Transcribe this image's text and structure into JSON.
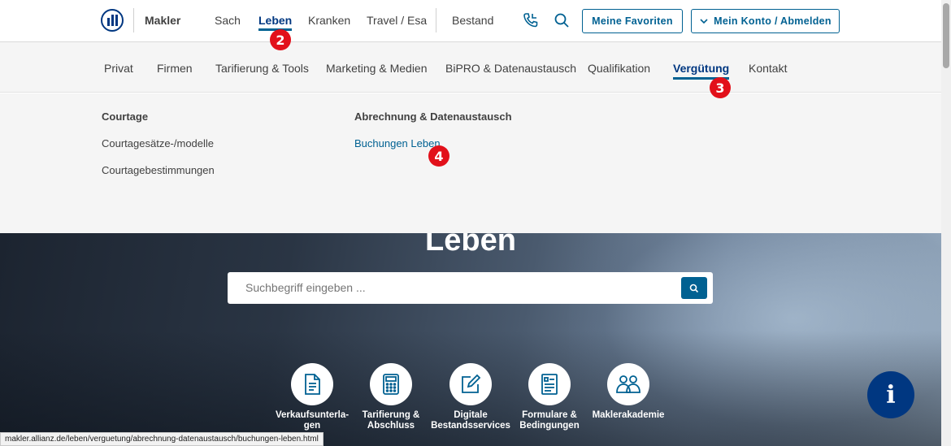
{
  "topbar": {
    "brand": "Makler",
    "nav": [
      "Sach",
      "Leben",
      "Kranken",
      "Travel / Esa",
      "Bestand"
    ],
    "favorites_label": "Meine Favoriten",
    "account_label": "Mein Konto / Abmelden"
  },
  "subnav": {
    "items": [
      "Privat",
      "Firmen",
      "Tarifierung & Tools",
      "Marketing & Medien",
      "BiPRO & Datenaustausch",
      "Qualifikation",
      "Vergütung",
      "Kontakt"
    ]
  },
  "mega_menu": {
    "col1_heading": "Courtage",
    "col1_links": [
      "Courtagesätze-/modelle",
      "Courtagebestimmungen"
    ],
    "col2_heading": "Abrechnung & Datenaustausch",
    "col2_links": [
      "Buchungen Leben"
    ]
  },
  "hero": {
    "title": "Leben",
    "search_placeholder": "Suchbegriff eingeben ...",
    "tiles": [
      {
        "label": "Verkaufsunterla-\ngen",
        "icon": "document-icon"
      },
      {
        "label": "Tarifierung &\nAbschluss",
        "icon": "calculator-icon"
      },
      {
        "label": "Digitale\nBestandsservices",
        "icon": "edit-icon"
      },
      {
        "label": "Formulare &\nBedingungen",
        "icon": "form-icon"
      },
      {
        "label": "Maklerakademie",
        "icon": "people-icon"
      }
    ],
    "info_label": "i"
  },
  "status_url": "makler.allianz.de/leben/verguetung/abrechnung-datenaustausch/buchungen-leben.html",
  "badges": [
    "2",
    "3",
    "4"
  ],
  "colors": {
    "primary": "#003781",
    "accent": "#006192",
    "badge": "#e2101a"
  }
}
